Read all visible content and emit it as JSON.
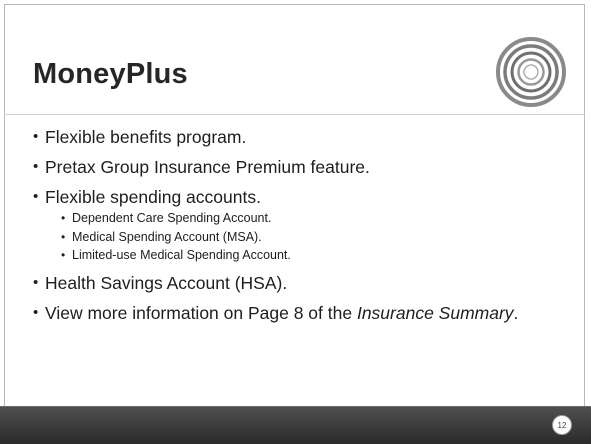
{
  "slide": {
    "title": "MoneyPlus",
    "bullets": [
      "Flexible benefits program.",
      "Pretax Group Insurance Premium feature.",
      "Flexible spending accounts."
    ],
    "sub_bullets": [
      "Dependent Care Spending Account.",
      "Medical Spending Account (MSA).",
      "Limited-use Medical Spending Account."
    ],
    "bullet_hsa": "Health Savings Account (HSA).",
    "more_info": {
      "prefix": "View more information on Page 8 of the ",
      "italic": "Insurance Summary",
      "suffix": "."
    },
    "page_number": "12"
  },
  "colors": {
    "footer": "#3a3a3a",
    "text": "#1e1e1e",
    "logo": "#7a7a7a"
  },
  "icons": {
    "logo": "concentric-circles-logo-icon"
  }
}
